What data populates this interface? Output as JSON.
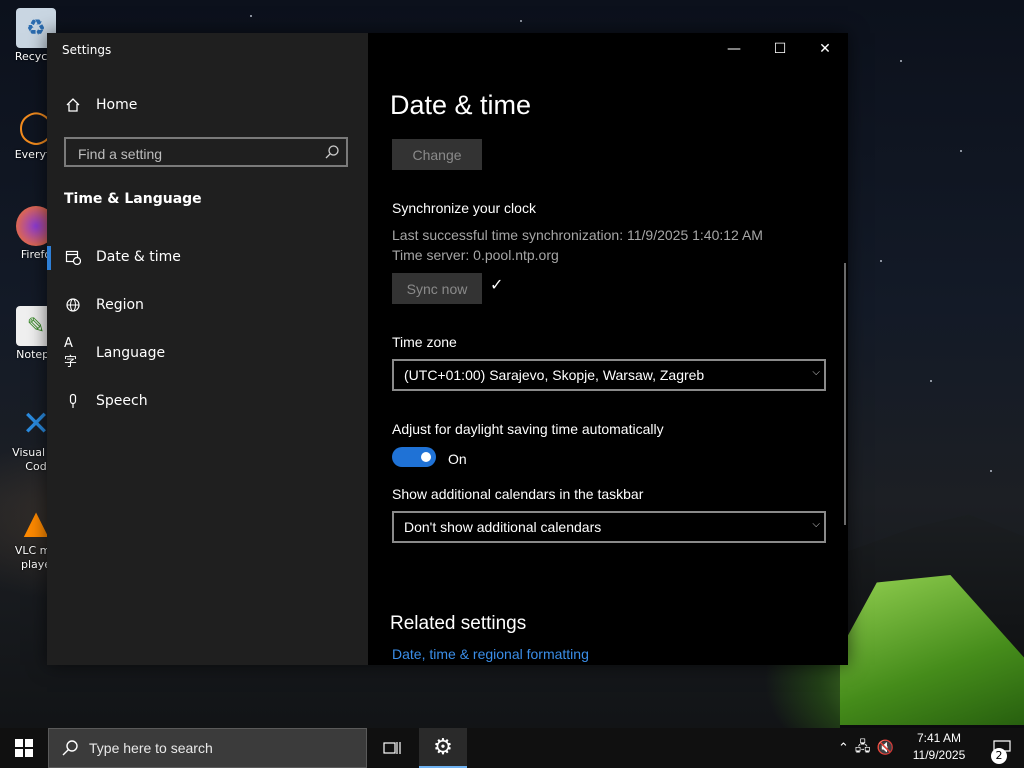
{
  "desktop": {
    "icons": [
      {
        "label": "Recycle",
        "icon": "recycle-bin-icon"
      },
      {
        "label": "Everyth",
        "icon": "everything-search-icon"
      },
      {
        "label": "Firefo",
        "icon": "firefox-icon"
      },
      {
        "label": "Notepa",
        "icon": "notepad-icon"
      },
      {
        "label": "Visual St Cod",
        "icon": "vscode-icon"
      },
      {
        "label": "VLC me playe",
        "icon": "vlc-icon"
      }
    ]
  },
  "window": {
    "title": "Settings",
    "controls": {
      "minimize": "—",
      "maximize": "☐",
      "close": "✕"
    }
  },
  "sidebar": {
    "home": "Home",
    "search_placeholder": "Find a setting",
    "section": "Time & Language",
    "items": [
      {
        "label": "Date & time",
        "icon": "calendar-clock-icon",
        "active": true
      },
      {
        "label": "Region",
        "icon": "globe-icon"
      },
      {
        "label": "Language",
        "icon": "language-icon"
      },
      {
        "label": "Speech",
        "icon": "microphone-icon"
      }
    ]
  },
  "content": {
    "title": "Date & time",
    "change_button": "Change",
    "sync": {
      "heading": "Synchronize your clock",
      "last_sync": "Last successful time synchronization: 11/9/2025 1:40:12 AM",
      "server": "Time server: 0.pool.ntp.org",
      "button": "Sync now",
      "check": "✓"
    },
    "timezone": {
      "label": "Time zone",
      "value": "(UTC+01:00) Sarajevo, Skopje, Warsaw, Zagreb"
    },
    "dst": {
      "label": "Adjust for daylight saving time automatically",
      "state": "On"
    },
    "calendars": {
      "label": "Show additional calendars in the taskbar",
      "value": "Don't show additional calendars"
    },
    "related": {
      "title": "Related settings",
      "link": "Date, time & regional formatting"
    }
  },
  "taskbar": {
    "search_placeholder": "Type here to search",
    "time": "7:41 AM",
    "date": "11/9/2025",
    "notifications": "2"
  },
  "colors": {
    "accent": "#1f72d6",
    "link": "#3b8ee8",
    "sidebar_bg": "#1f1f1f",
    "content_bg": "#000000"
  }
}
